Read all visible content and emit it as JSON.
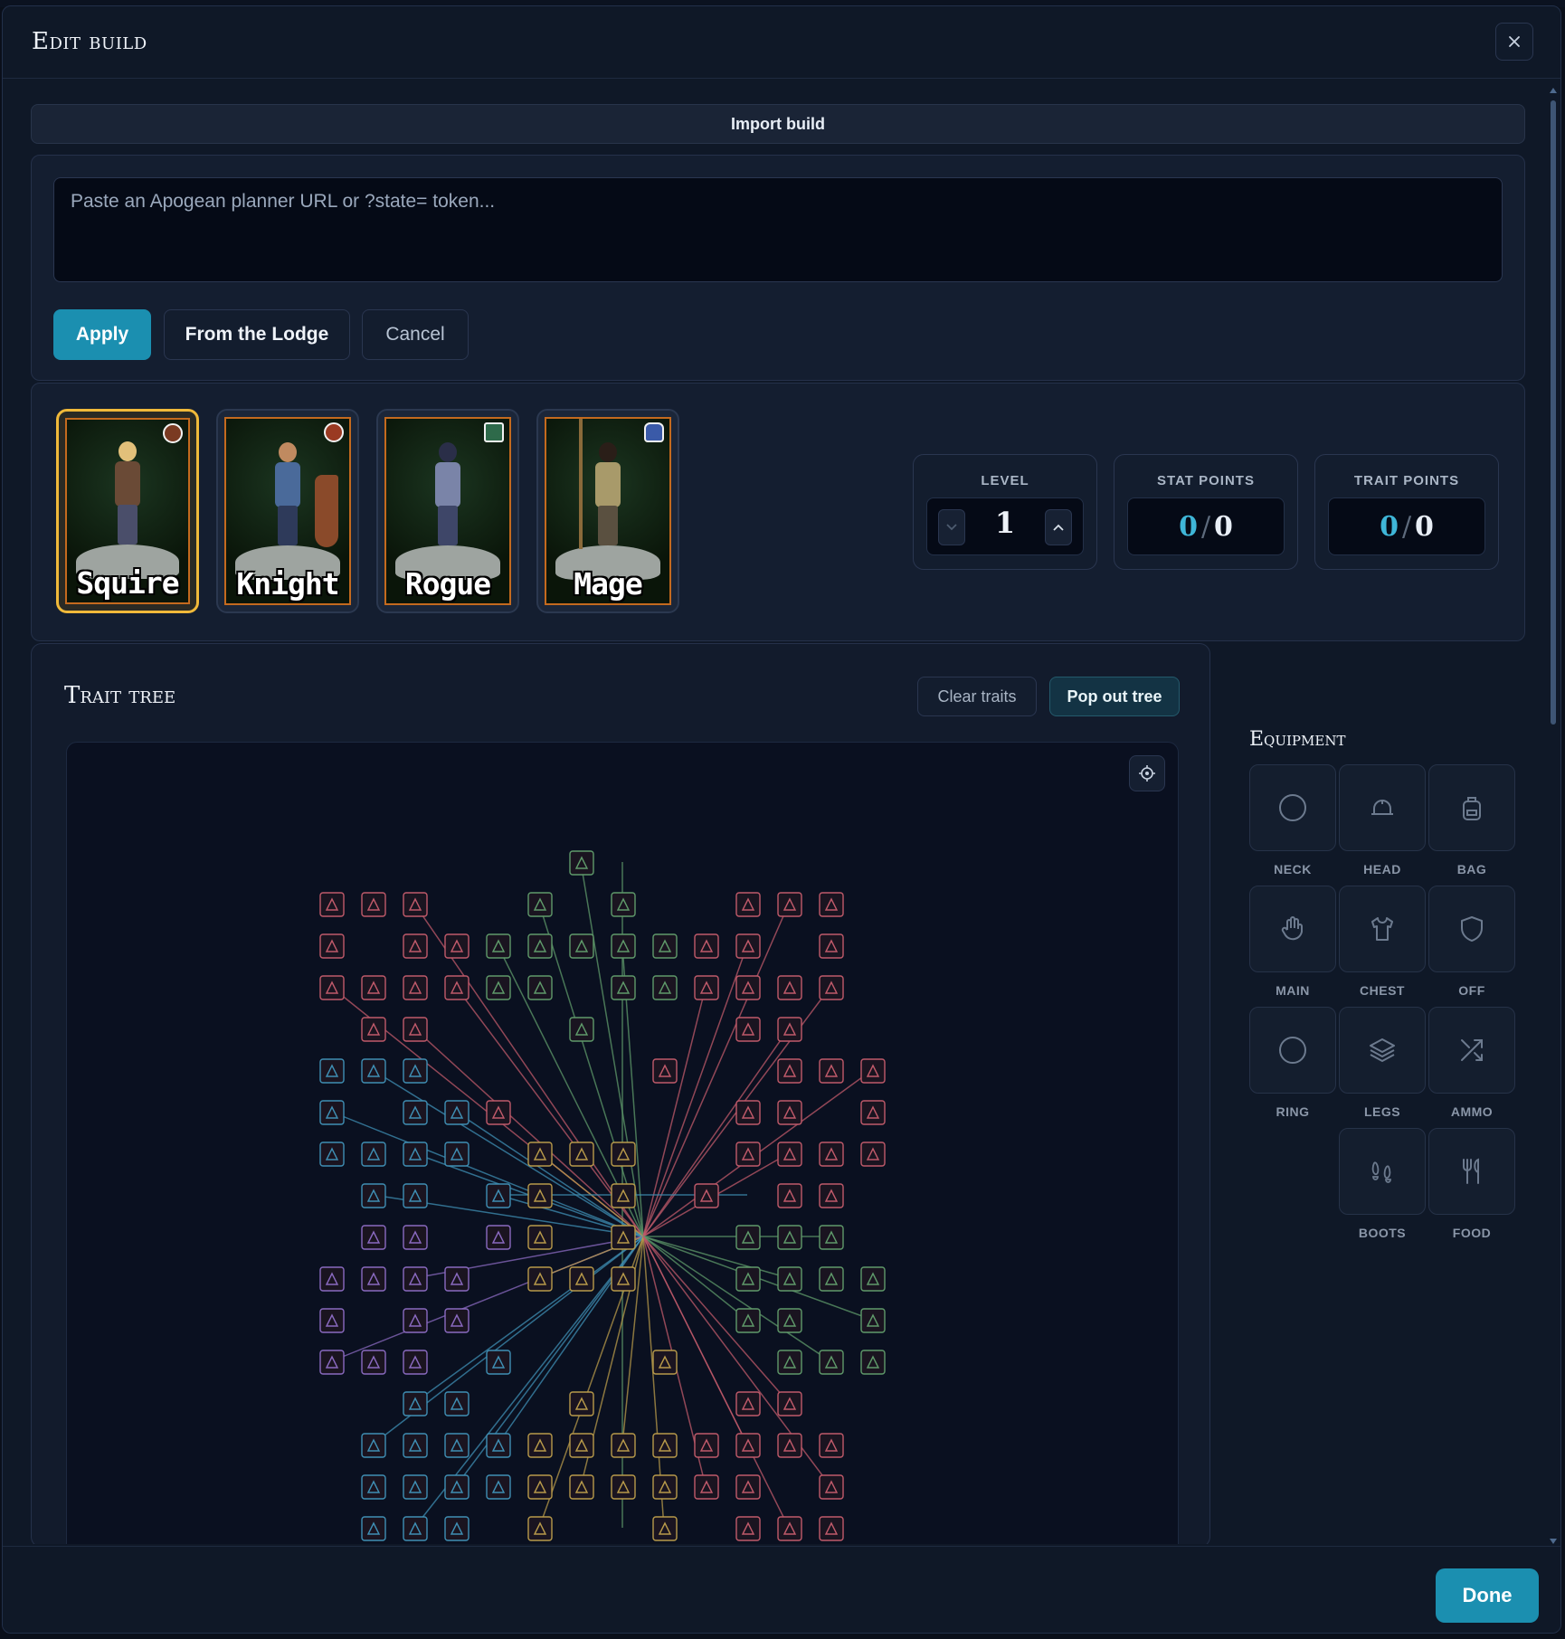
{
  "modal": {
    "title": "Edit build",
    "close_icon": "close-icon"
  },
  "import": {
    "section_label": "Import build",
    "placeholder": "Paste an Apogean planner URL or ?state= token...",
    "value": "",
    "apply_label": "Apply",
    "lodge_label": "From the Lodge",
    "cancel_label": "Cancel"
  },
  "classes": [
    {
      "name": "Squire",
      "selected": true
    },
    {
      "name": "Knight",
      "selected": false
    },
    {
      "name": "Rogue",
      "selected": false
    },
    {
      "name": "Mage",
      "selected": false
    }
  ],
  "stats": {
    "level_label": "LEVEL",
    "level_value": "1",
    "stat_points_label": "STAT POINTS",
    "stat_points_current": "0",
    "stat_points_sep": "/",
    "stat_points_total": "0",
    "trait_points_label": "TRAIT POINTS",
    "trait_points_current": "0",
    "trait_points_sep": "/",
    "trait_points_total": "0"
  },
  "trait_tree": {
    "title": "Trait tree",
    "clear_label": "Clear traits",
    "pop_out_label": "Pop out tree",
    "recenter_icon": "crosshair-icon"
  },
  "equipment": {
    "title": "Equipment",
    "slots": [
      {
        "label": "NECK",
        "icon": "circle-icon"
      },
      {
        "label": "HEAD",
        "icon": "helmet-icon"
      },
      {
        "label": "BAG",
        "icon": "backpack-icon"
      },
      {
        "label": "MAIN",
        "icon": "hand-icon"
      },
      {
        "label": "CHEST",
        "icon": "shirt-icon"
      },
      {
        "label": "OFF",
        "icon": "shield-icon"
      },
      {
        "label": "RING",
        "icon": "ring-icon"
      },
      {
        "label": "LEGS",
        "icon": "layers-icon"
      },
      {
        "label": "AMMO",
        "icon": "arrows-icon"
      },
      {
        "label": "BOOTS",
        "icon": "footprints-icon"
      },
      {
        "label": "FOOD",
        "icon": "utensils-icon"
      }
    ]
  },
  "footer": {
    "done_label": "Done"
  },
  "colors": {
    "accent": "#1b8fb0",
    "selected_border": "#f0b93a",
    "points_value": "#3fb6d8",
    "squire_branch": "#c05a6a",
    "knight_branch": "#3f8fb4",
    "rogue_branch": "#5f9a6a",
    "mage_branch": "#8a6ac0",
    "core_branch": "#b89a4a"
  }
}
